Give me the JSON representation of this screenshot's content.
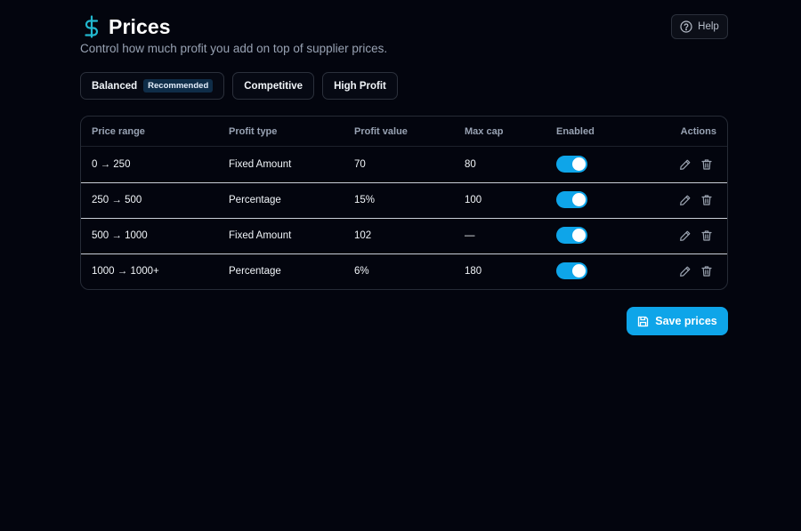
{
  "header": {
    "title": "Prices",
    "subtitle": "Control how much profit you add on top of supplier prices.",
    "help_label": "Help"
  },
  "presets": [
    {
      "label": "Balanced",
      "badge": "Recommended"
    },
    {
      "label": "Competitive"
    },
    {
      "label": "High Profit"
    }
  ],
  "table": {
    "columns": [
      "Price range",
      "Profit type",
      "Profit value",
      "Max cap",
      "Enabled",
      "Actions"
    ],
    "rows": [
      {
        "range": "0 → 250",
        "type": "Fixed Amount",
        "value": "70",
        "cap": "80",
        "enabled": true
      },
      {
        "range": "250 → 500",
        "type": "Percentage",
        "value": "15%",
        "cap": "100",
        "enabled": true
      },
      {
        "range": "500 → 1000",
        "type": "Fixed Amount",
        "value": "102",
        "cap": "—",
        "enabled": true
      },
      {
        "range": "1000 → 1000+",
        "type": "Percentage",
        "value": "6%",
        "cap": "180",
        "enabled": true
      }
    ]
  },
  "save_label": "Save prices",
  "icons": {
    "title": "dollar-icon",
    "help": "help-circle-icon",
    "edit": "pencil-icon",
    "delete": "trash-icon",
    "save": "save-icon"
  },
  "colors": {
    "background": "#03050e",
    "accent": "#0ea5e9",
    "title_icon": "#22b8cf",
    "badge_bg": "#0f2d48"
  }
}
